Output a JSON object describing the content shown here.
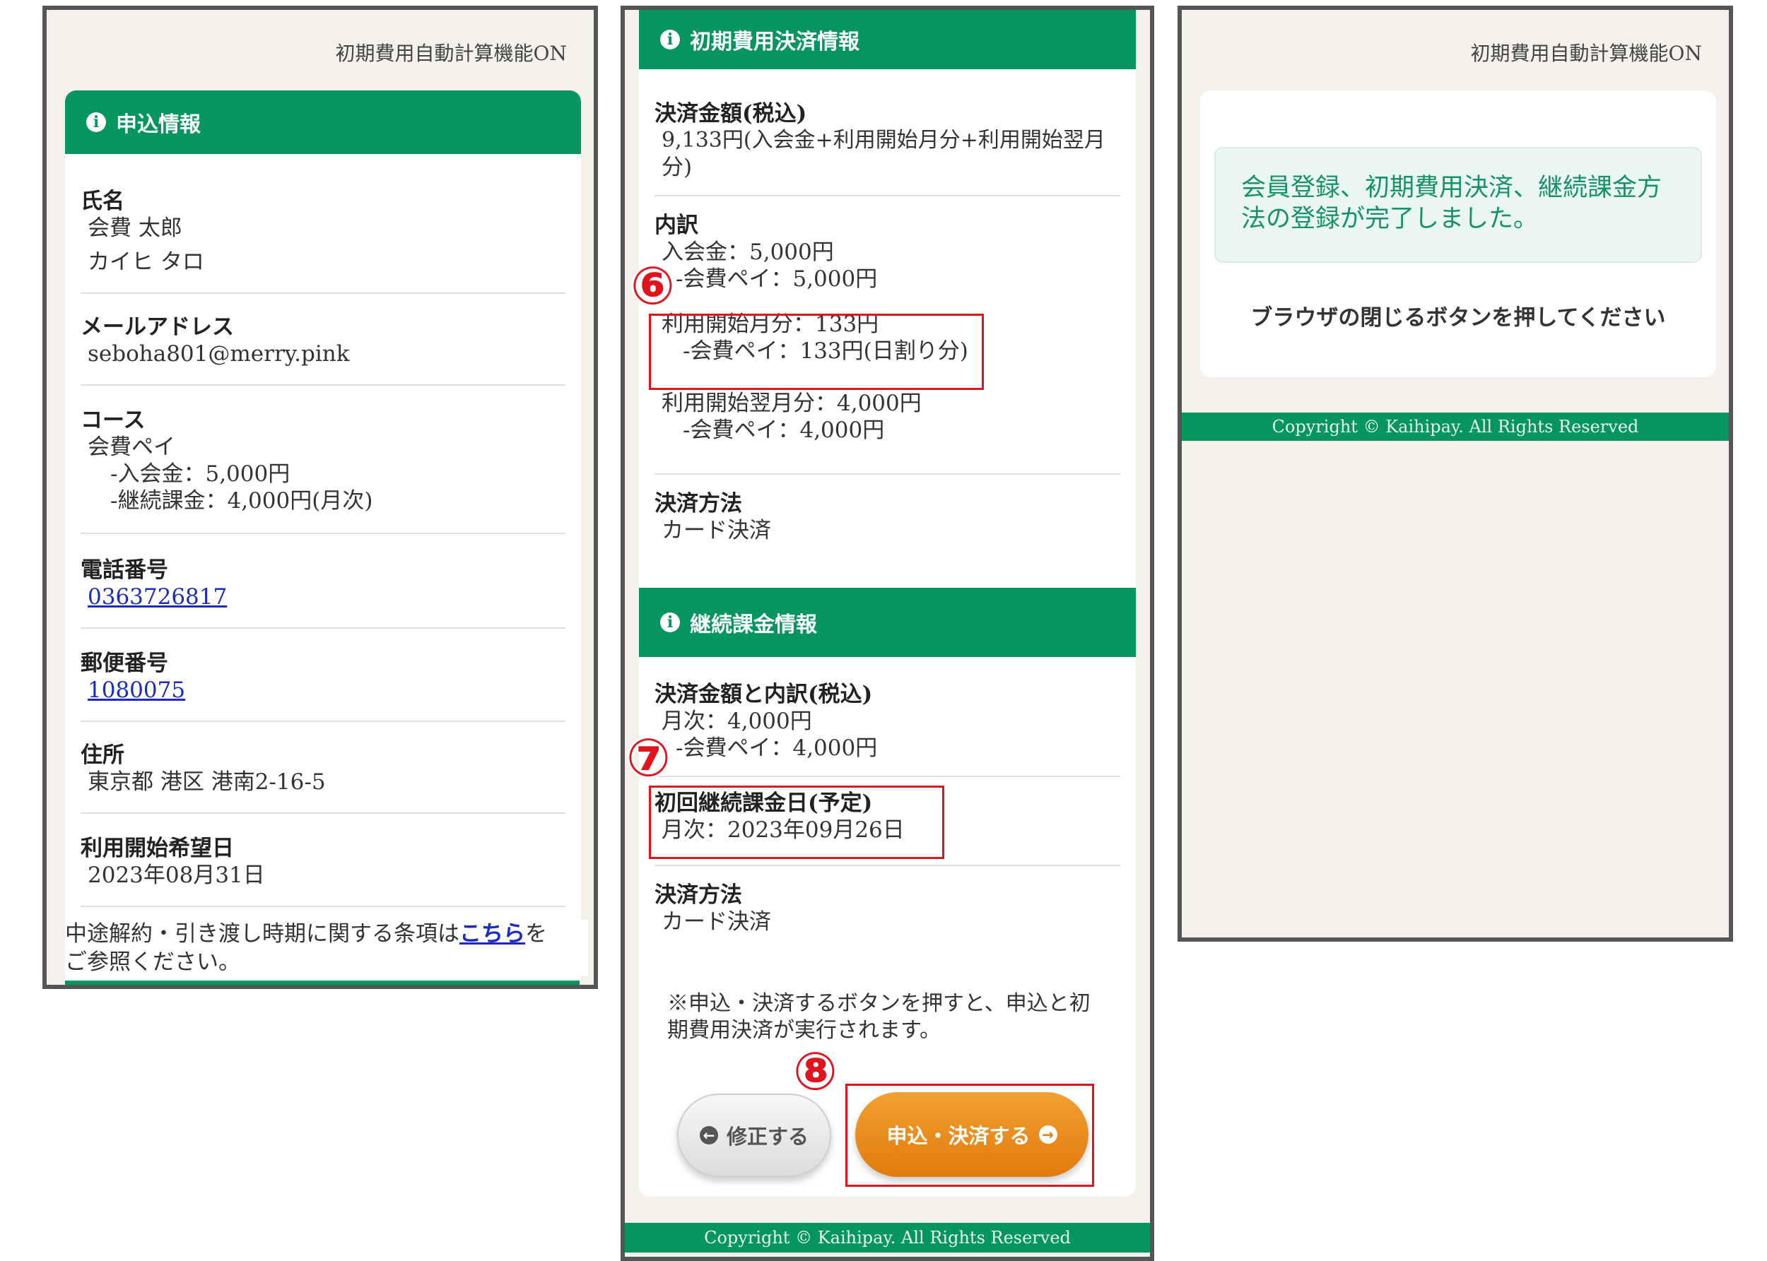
{
  "phone1": {
    "header": "初期費用自動計算機能ON",
    "section_title": "申込情報",
    "name_label": "氏名",
    "name_value": "会費 太郎",
    "name_kana": "カイヒ タロ",
    "email_label": "メールアドレス",
    "email_value": "seboha801@merry.pink",
    "course_label": "コース",
    "course_name": "会費ペイ",
    "course_entry_fee": "-入会金：5,000円",
    "course_recurring": "-継続課金：4,000円(月次)",
    "phone_label": "電話番号",
    "phone_value": "0363726817",
    "postal_label": "郵便番号",
    "postal_value": "1080075",
    "address_label": "住所",
    "address_value": "東京都 港区 港南2-16-5",
    "start_label": "利用開始希望日",
    "start_value": "2023年08月31日",
    "terms_before": "中途解約・引き渡し時期に関する条項は",
    "terms_link": "こちら",
    "terms_after": "を",
    "terms_line2": "ご参照ください。"
  },
  "phone2": {
    "initial_title": "初期費用決済情報",
    "amount_label": "決済金額(税込)",
    "amount_line1": "9,133円(入会金+利用開始月分+利用開始翌月",
    "amount_line2": "分)",
    "breakdown_label": "内訳",
    "entry_fee": "入会金：5,000円",
    "entry_fee_sub": "-会費ペイ：5,000円",
    "first_month": "利用開始月分：133円",
    "first_month_sub": "-会費ペイ：133円(日割り分)",
    "next_month": "利用開始翌月分：4,000円",
    "next_month_sub": "-会費ペイ：4,000円",
    "method_label": "決済方法",
    "method_value": "カード決済",
    "recurring_title": "継続課金情報",
    "rec_amount_label": "決済金額と内訳(税込)",
    "rec_monthly": "月次：4,000円",
    "rec_monthly_sub": "-会費ペイ：4,000円",
    "first_charge_label": "初回継続課金日(予定)",
    "first_charge_value": "月次：2023年09月26日",
    "rec_method_label": "決済方法",
    "rec_method_value": "カード決済",
    "note_line1": "※申込・決済するボタンを押すと、申込と初",
    "note_line2": "期費用決済が実行されます。",
    "edit_button": "修正する",
    "submit_button": "申込・決済する",
    "footer": "Copyright © Kaihipay. All Rights Reserved",
    "badges": [
      "⑥",
      "⑦",
      "⑧"
    ]
  },
  "phone3": {
    "header": "初期費用自動計算機能ON",
    "success_line1": "会員登録、初期費用決済、継続課金方",
    "success_line2": "法の登録が完了しました。",
    "instruction": "ブラウザの閉じるボタンを押してください",
    "footer": "Copyright © Kaihipay. All Rights Reserved"
  },
  "colors": {
    "brand_green": "#05955e",
    "accent_orange": "#ef8a14",
    "annotation_red": "#e0141c",
    "link_blue": "#1a2bbd"
  }
}
